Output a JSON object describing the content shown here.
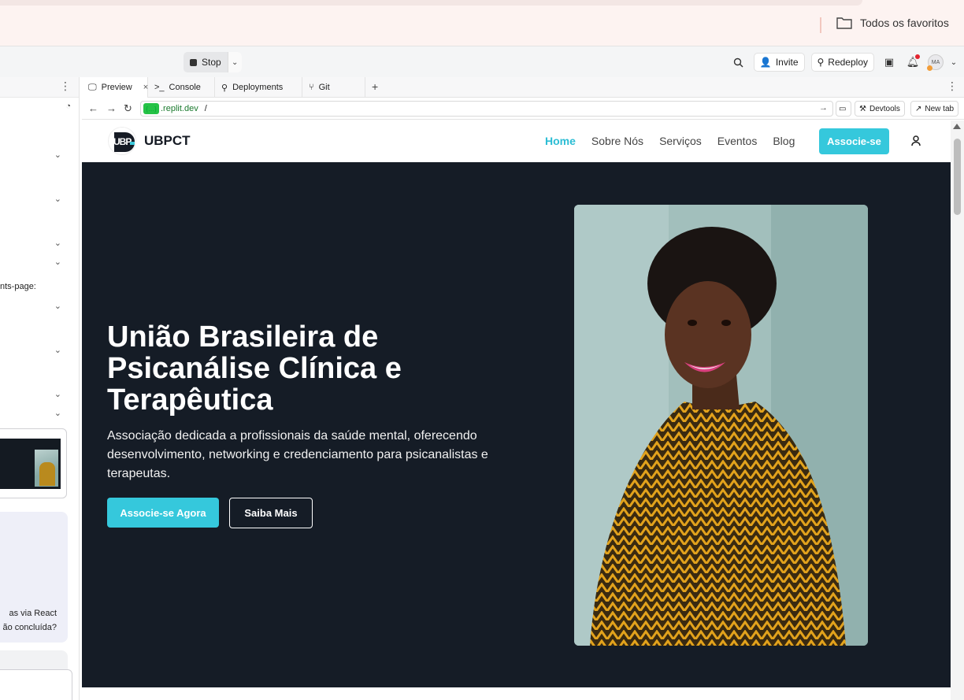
{
  "browser": {
    "bookmarks_folder": "Todos os favoritos"
  },
  "toolbar": {
    "stop_label": "Stop",
    "invite_label": "Invite",
    "redeploy_label": "Redeploy",
    "avatar_initials": "MA"
  },
  "left_panel": {
    "fragment_1": "nts-page:",
    "chat_line_1": "as via React",
    "chat_line_2": "ão concluída?"
  },
  "tabs": [
    {
      "label": "Preview",
      "icon": "monitor-icon"
    },
    {
      "label": "Console",
      "icon": "terminal-icon"
    },
    {
      "label": "Deployments",
      "icon": "deploy-icon"
    },
    {
      "label": "Git",
      "icon": "git-icon"
    }
  ],
  "urlbar": {
    "host": ".replit.dev",
    "path": "/",
    "devtools_label": "Devtools",
    "newtab_label": "New tab"
  },
  "site": {
    "brand": "UBPCT",
    "logo_text": "UBP",
    "nav": [
      "Home",
      "Sobre Nós",
      "Serviços",
      "Eventos",
      "Blog"
    ],
    "nav_cta": "Associe-se",
    "hero_title": "União Brasileira de Psicanálise Clínica e Terapêutica",
    "hero_subtitle": "Associação dedicada a profissionais da saúde mental, oferecendo desenvolvimento, networking e credenciamento para psicanalistas e terapeutas.",
    "btn_primary": "Associe-se Agora",
    "btn_secondary": "Saiba Mais",
    "colors": {
      "accent": "#35c8dc",
      "hero_bg": "#151c26"
    }
  }
}
